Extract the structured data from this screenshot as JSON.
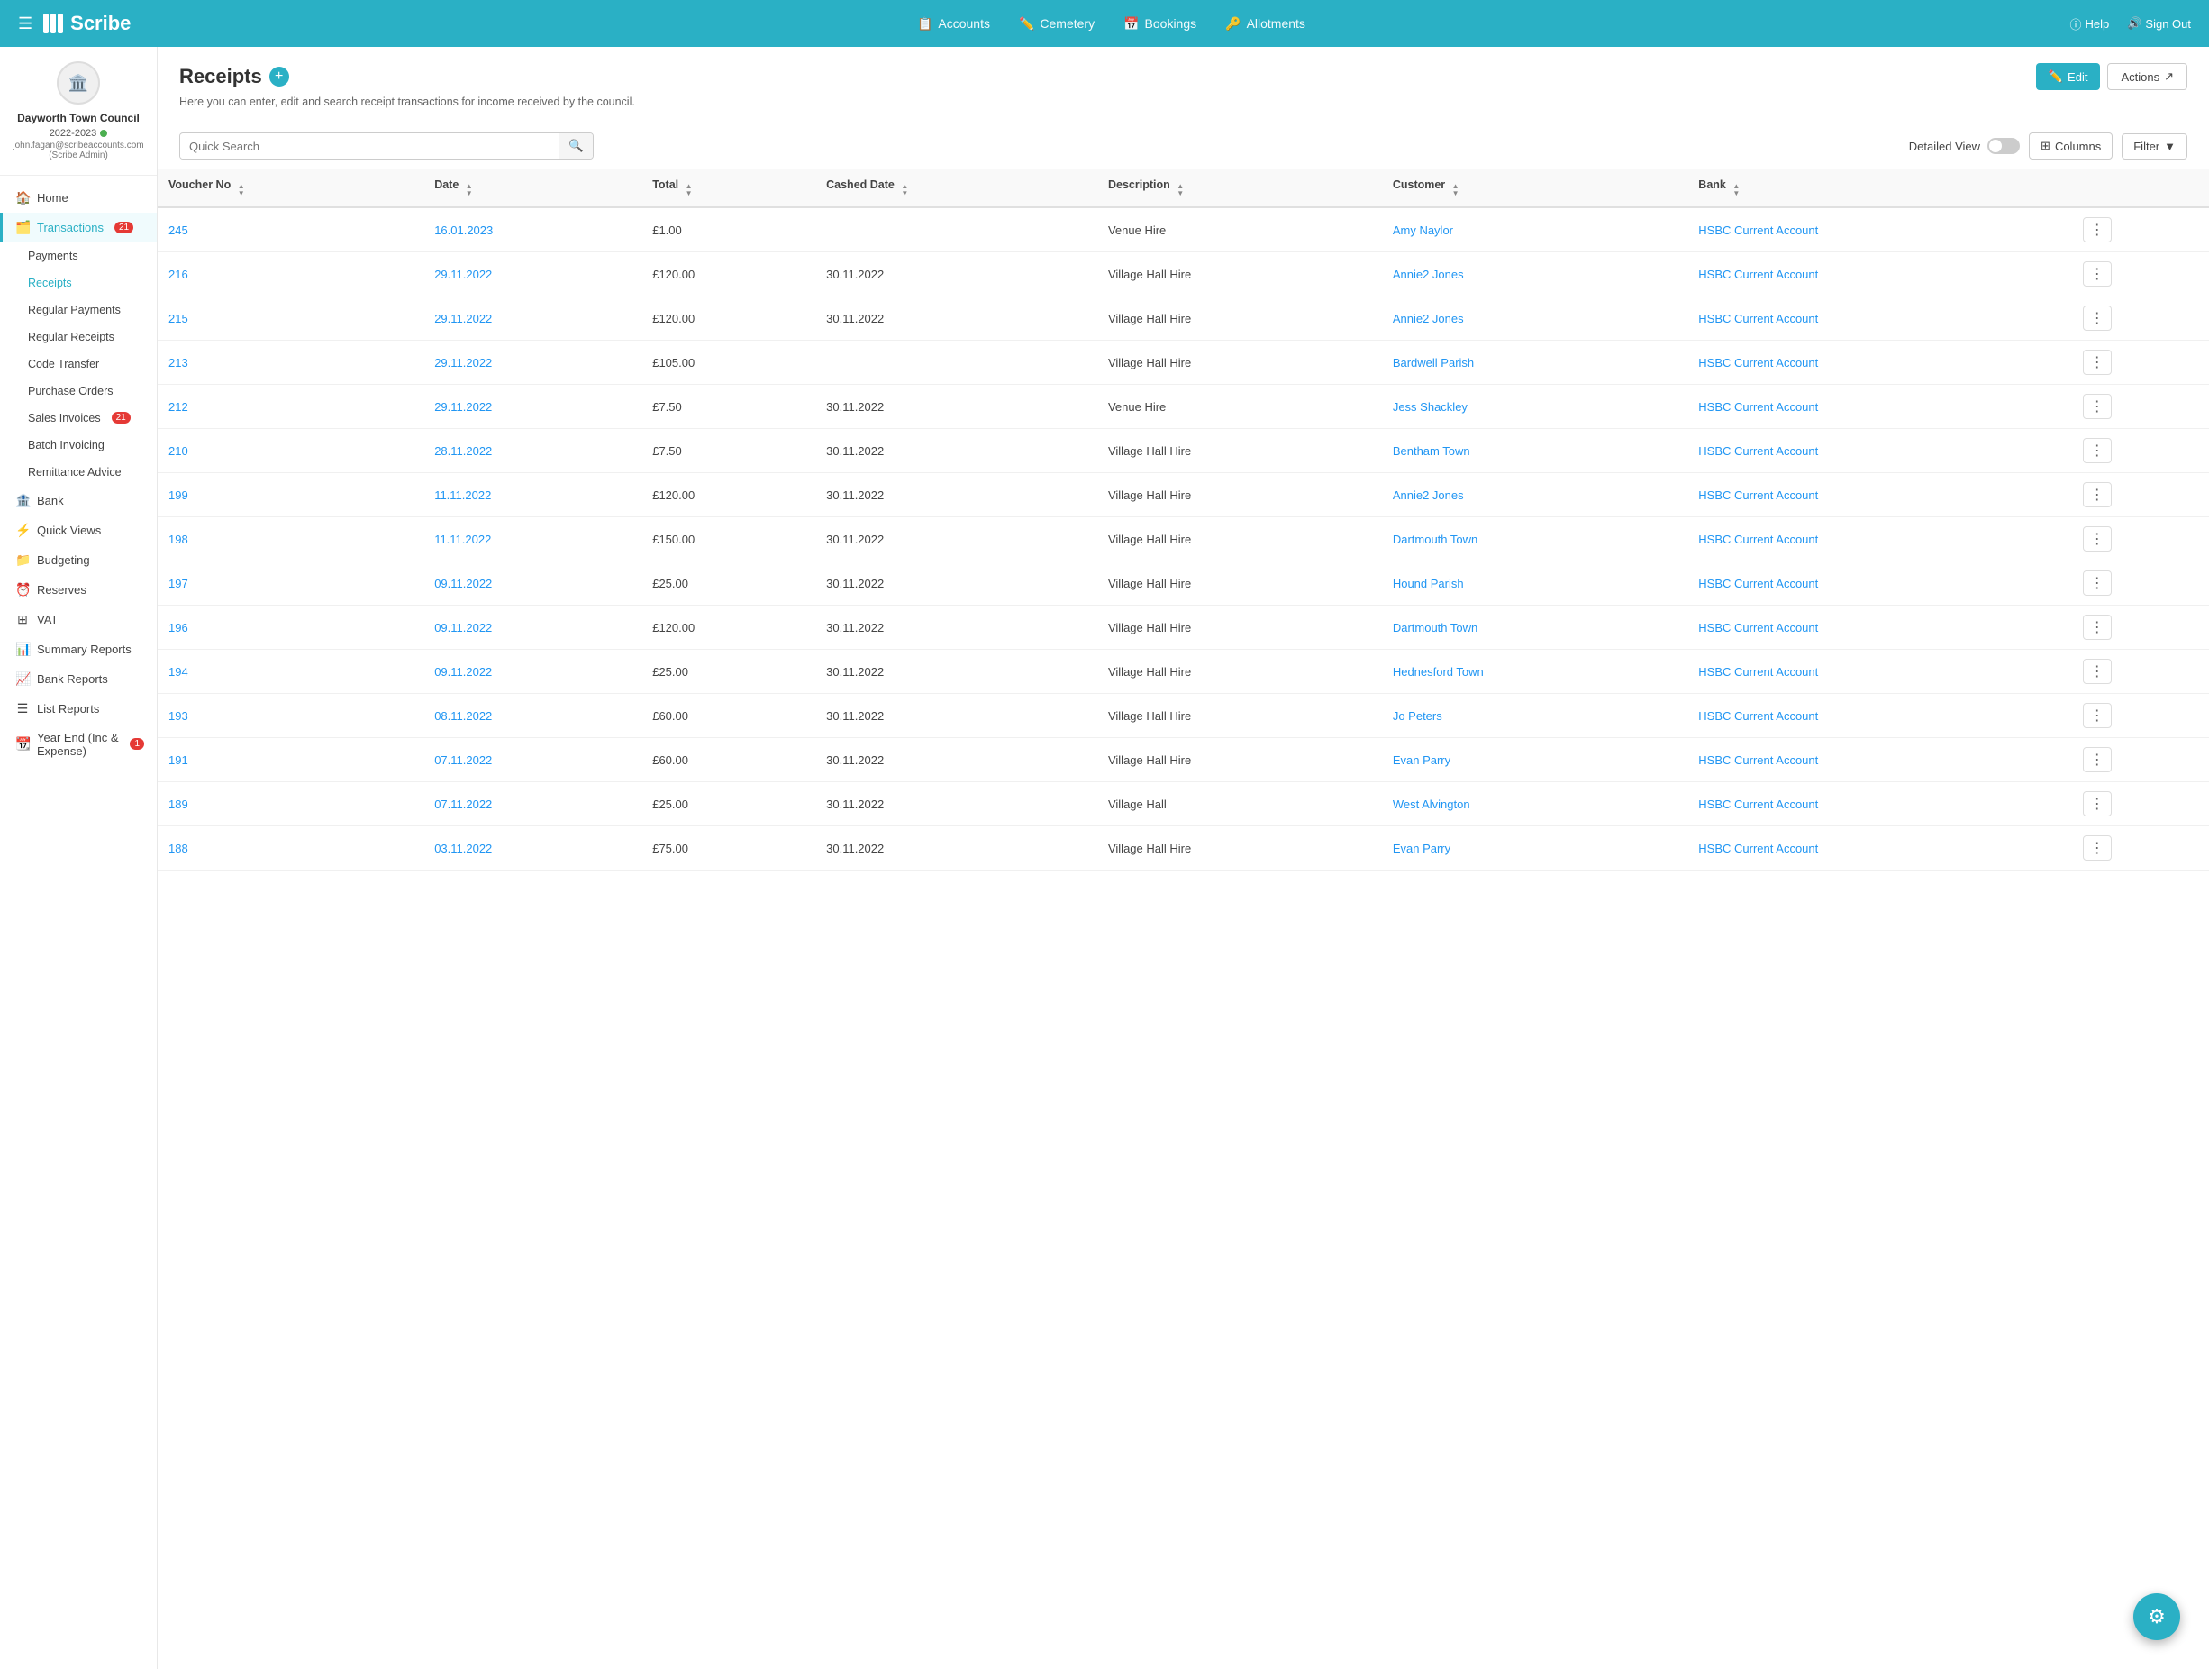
{
  "app": {
    "name": "Scribe"
  },
  "topnav": {
    "hamburger": "☰",
    "logo_text": "Scribe",
    "links": [
      {
        "label": "Accounts",
        "icon": "📋"
      },
      {
        "label": "Cemetery",
        "icon": "✏️"
      },
      {
        "label": "Bookings",
        "icon": "📅"
      },
      {
        "label": "Allotments",
        "icon": "🔑"
      }
    ],
    "help_label": "Help",
    "signout_label": "Sign Out"
  },
  "user": {
    "council": "Dayworth Town Council",
    "year": "2022-2023",
    "email": "john.fagan@scribeaccounts.com",
    "role": "(Scribe Admin)"
  },
  "sidebar": {
    "home_label": "Home",
    "transactions_label": "Transactions",
    "transactions_badge": "21",
    "sub_items": [
      {
        "label": "Payments",
        "active": false
      },
      {
        "label": "Receipts",
        "active": true
      },
      {
        "label": "Regular Payments",
        "active": false
      },
      {
        "label": "Regular Receipts",
        "active": false
      },
      {
        "label": "Code Transfer",
        "active": false
      },
      {
        "label": "Purchase Orders",
        "active": false
      },
      {
        "label": "Sales Invoices",
        "badge": "21",
        "active": false
      },
      {
        "label": "Batch Invoicing",
        "active": false
      },
      {
        "label": "Remittance Advice",
        "active": false
      }
    ],
    "bank_label": "Bank",
    "quick_views_label": "Quick Views",
    "budgeting_label": "Budgeting",
    "reserves_label": "Reserves",
    "vat_label": "VAT",
    "summary_reports_label": "Summary Reports",
    "bank_reports_label": "Bank Reports",
    "list_reports_label": "List Reports",
    "year_end_label": "Year End (Inc & Expense)",
    "year_end_badge": "1"
  },
  "page": {
    "title": "Receipts",
    "subtitle": "Here you can enter, edit and search receipt transactions for income received by the council.",
    "edit_label": "Edit",
    "actions_label": "Actions"
  },
  "toolbar": {
    "search_placeholder": "Quick Search",
    "detailed_view_label": "Detailed View",
    "columns_label": "Columns",
    "filter_label": "Filter"
  },
  "table": {
    "columns": [
      {
        "label": "Voucher No",
        "sortable": true,
        "sort_asc": true
      },
      {
        "label": "Date",
        "sortable": true
      },
      {
        "label": "Total",
        "sortable": true
      },
      {
        "label": "Cashed Date",
        "sortable": true
      },
      {
        "label": "Description",
        "sortable": true
      },
      {
        "label": "Customer",
        "sortable": true
      },
      {
        "label": "Bank",
        "sortable": true
      },
      {
        "label": ""
      }
    ],
    "rows": [
      {
        "voucher": "245",
        "date": "16.01.2023",
        "total": "£1.00",
        "cashed": "",
        "description": "Venue Hire",
        "customer": "Amy Naylor",
        "bank": "HSBC Current Account"
      },
      {
        "voucher": "216",
        "date": "29.11.2022",
        "total": "£120.00",
        "cashed": "30.11.2022",
        "description": "Village Hall Hire",
        "customer": "Annie2 Jones",
        "bank": "HSBC Current Account"
      },
      {
        "voucher": "215",
        "date": "29.11.2022",
        "total": "£120.00",
        "cashed": "30.11.2022",
        "description": "Village Hall Hire",
        "customer": "Annie2 Jones",
        "bank": "HSBC Current Account"
      },
      {
        "voucher": "213",
        "date": "29.11.2022",
        "total": "£105.00",
        "cashed": "",
        "description": "Village Hall Hire",
        "customer": "Bardwell Parish",
        "bank": "HSBC Current Account"
      },
      {
        "voucher": "212",
        "date": "29.11.2022",
        "total": "£7.50",
        "cashed": "30.11.2022",
        "description": "Venue Hire",
        "customer": "Jess Shackley",
        "bank": "HSBC Current Account"
      },
      {
        "voucher": "210",
        "date": "28.11.2022",
        "total": "£7.50",
        "cashed": "30.11.2022",
        "description": "Village Hall Hire",
        "customer": "Bentham Town",
        "bank": "HSBC Current Account"
      },
      {
        "voucher": "199",
        "date": "11.11.2022",
        "total": "£120.00",
        "cashed": "30.11.2022",
        "description": "Village Hall Hire",
        "customer": "Annie2 Jones",
        "bank": "HSBC Current Account"
      },
      {
        "voucher": "198",
        "date": "11.11.2022",
        "total": "£150.00",
        "cashed": "30.11.2022",
        "description": "Village Hall Hire",
        "customer": "Dartmouth Town",
        "bank": "HSBC Current Account"
      },
      {
        "voucher": "197",
        "date": "09.11.2022",
        "total": "£25.00",
        "cashed": "30.11.2022",
        "description": "Village Hall Hire",
        "customer": "Hound Parish",
        "bank": "HSBC Current Account"
      },
      {
        "voucher": "196",
        "date": "09.11.2022",
        "total": "£120.00",
        "cashed": "30.11.2022",
        "description": "Village Hall Hire",
        "customer": "Dartmouth Town",
        "bank": "HSBC Current Account"
      },
      {
        "voucher": "194",
        "date": "09.11.2022",
        "total": "£25.00",
        "cashed": "30.11.2022",
        "description": "Village Hall Hire",
        "customer": "Hednesford Town",
        "bank": "HSBC Current Account"
      },
      {
        "voucher": "193",
        "date": "08.11.2022",
        "total": "£60.00",
        "cashed": "30.11.2022",
        "description": "Village Hall Hire",
        "customer": "Jo Peters",
        "bank": "HSBC Current Account"
      },
      {
        "voucher": "191",
        "date": "07.11.2022",
        "total": "£60.00",
        "cashed": "30.11.2022",
        "description": "Village Hall Hire",
        "customer": "Evan Parry",
        "bank": "HSBC Current Account"
      },
      {
        "voucher": "189",
        "date": "07.11.2022",
        "total": "£25.00",
        "cashed": "30.11.2022",
        "description": "Village Hall",
        "customer": "West Alvington",
        "bank": "HSBC Current Account"
      },
      {
        "voucher": "188",
        "date": "03.11.2022",
        "total": "£75.00",
        "cashed": "30.11.2022",
        "description": "Village Hall Hire",
        "customer": "Evan Parry",
        "bank": "HSBC Current Account"
      }
    ]
  }
}
